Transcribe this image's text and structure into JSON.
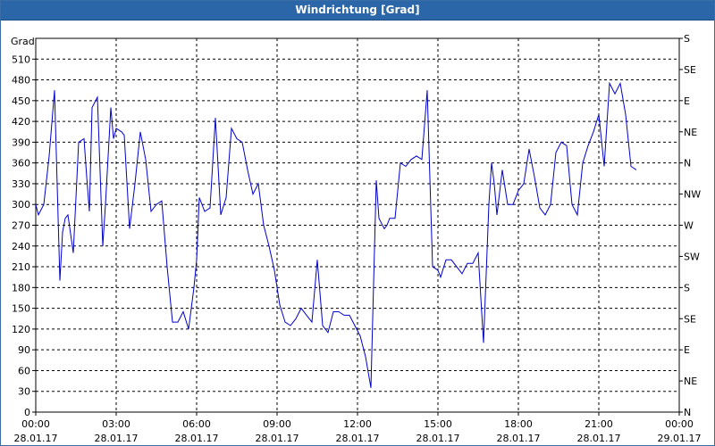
{
  "window": {
    "title": "Windrichtung [Grad]"
  },
  "chart_data": {
    "type": "line",
    "title": "Windrichtung [Grad]",
    "ylabel": "Grad",
    "ylim": [
      0,
      540
    ],
    "y_ticks": [
      0,
      30,
      60,
      90,
      120,
      150,
      180,
      210,
      240,
      270,
      300,
      330,
      360,
      390,
      420,
      450,
      480,
      510
    ],
    "right_axis_labels": [
      "N",
      "NE",
      "E",
      "SE",
      "S",
      "SW",
      "W",
      "NW",
      "N",
      "NE",
      "E",
      "SE",
      "S"
    ],
    "x_tick_labels": [
      {
        "time": "00:00",
        "date": "28.01.17"
      },
      {
        "time": "03:00",
        "date": "28.01.17"
      },
      {
        "time": "06:00",
        "date": "28.01.17"
      },
      {
        "time": "09:00",
        "date": "28.01.17"
      },
      {
        "time": "12:00",
        "date": "28.01.17"
      },
      {
        "time": "15:00",
        "date": "28.01.17"
      },
      {
        "time": "18:00",
        "date": "28.01.17"
      },
      {
        "time": "21:00",
        "date": "28.01.17"
      },
      {
        "time": "00:00",
        "date": "29.01.17"
      }
    ],
    "grid": true,
    "line_color": "#0000cc",
    "series": [
      {
        "x_hours": [
          0.0,
          0.1,
          0.3,
          0.5,
          0.7,
          0.9,
          1.0,
          1.1,
          1.2,
          1.4,
          1.6,
          1.8,
          1.9,
          2.0,
          2.1,
          2.3,
          2.5,
          2.6,
          2.8,
          2.9,
          3.0,
          3.2,
          3.3,
          3.5,
          3.7,
          3.9,
          4.1,
          4.3,
          4.5,
          4.7,
          4.9,
          5.1,
          5.3,
          5.5,
          5.7,
          5.9,
          6.0,
          6.1,
          6.3,
          6.5,
          6.7,
          6.9,
          7.1,
          7.3,
          7.5,
          7.7,
          7.9,
          8.1,
          8.3,
          8.5,
          8.7,
          8.9,
          9.1,
          9.3,
          9.5,
          9.7,
          9.9,
          10.1,
          10.3,
          10.5,
          10.7,
          10.9,
          11.1,
          11.3,
          11.5,
          11.7,
          11.9,
          12.1,
          12.3,
          12.5,
          12.7,
          12.8,
          13.0,
          13.1,
          13.2,
          13.4,
          13.6,
          13.8,
          14.0,
          14.2,
          14.4,
          14.6,
          14.8,
          15.0,
          15.1,
          15.3,
          15.5,
          15.7,
          15.9,
          16.1,
          16.3,
          16.5,
          16.7,
          16.9,
          17.0,
          17.1,
          17.2,
          17.4,
          17.6,
          17.8,
          18.0,
          18.2,
          18.4,
          18.6,
          18.8,
          19.0,
          19.2,
          19.4,
          19.6,
          19.8,
          20.0,
          20.2,
          20.4,
          20.6,
          20.8,
          21.0,
          21.2,
          21.4,
          21.6,
          21.8,
          22.0,
          22.2,
          22.4,
          22.6,
          22.8,
          23.0,
          23.2,
          23.4,
          23.6,
          23.8,
          24.0
        ],
        "values": [
          300,
          285,
          300,
          370,
          465,
          190,
          260,
          280,
          285,
          230,
          390,
          395,
          340,
          290,
          440,
          455,
          240,
          300,
          440,
          395,
          410,
          405,
          400,
          265,
          330,
          405,
          365,
          290,
          300,
          305,
          210,
          130,
          130,
          145,
          120,
          180,
          220,
          310,
          290,
          295,
          425,
          285,
          310,
          410,
          395,
          390,
          350,
          315,
          330,
          270,
          240,
          205,
          155,
          130,
          125,
          135,
          150,
          140,
          130,
          220,
          125,
          115,
          145,
          145,
          140,
          140,
          125,
          110,
          80,
          35,
          335,
          280,
          265,
          270,
          280,
          280,
          360,
          355,
          365,
          370,
          365,
          465,
          210,
          205,
          195,
          220,
          220,
          210,
          200,
          215,
          215,
          230,
          100,
          300,
          360,
          330,
          285,
          350,
          300,
          300,
          320,
          330,
          380,
          340,
          295,
          285,
          300,
          375,
          390,
          385,
          300,
          285,
          360,
          385,
          405,
          430,
          355,
          475,
          460,
          475,
          430,
          355,
          350
        ]
      }
    ]
  }
}
